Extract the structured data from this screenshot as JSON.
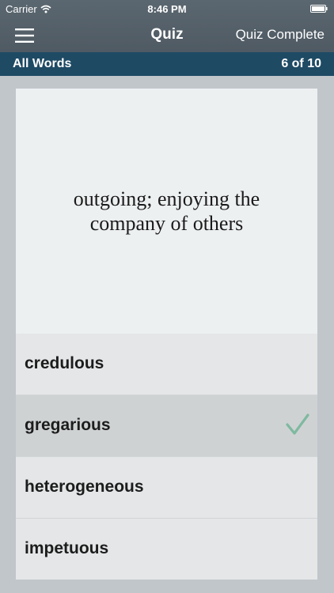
{
  "status_bar": {
    "carrier": "Carrier",
    "time": "8:46 PM",
    "icons": [
      "wifi-icon",
      "battery-icon"
    ]
  },
  "navbar": {
    "menu_icon": "hamburger-menu-icon",
    "title": "Quiz",
    "right_label": "Quiz Complete"
  },
  "info_bar": {
    "list_name": "All Words",
    "progress": "6 of 10"
  },
  "question": {
    "definition": "outgoing; enjoying the company of others"
  },
  "answers": [
    {
      "label": "credulous",
      "selected": false
    },
    {
      "label": "gregarious",
      "selected": true
    },
    {
      "label": "heterogeneous",
      "selected": false
    },
    {
      "label": "impetuous",
      "selected": false
    }
  ],
  "colors": {
    "nav_background": "#55616a",
    "info_bar_background": "#1e4a64",
    "card_background": "#edf0f1",
    "answer_background": "#e4e6e7",
    "selected_answer_background": "#cfd2d3",
    "check_color": "#7fb9a0",
    "page_background": "#c1c6cb"
  }
}
